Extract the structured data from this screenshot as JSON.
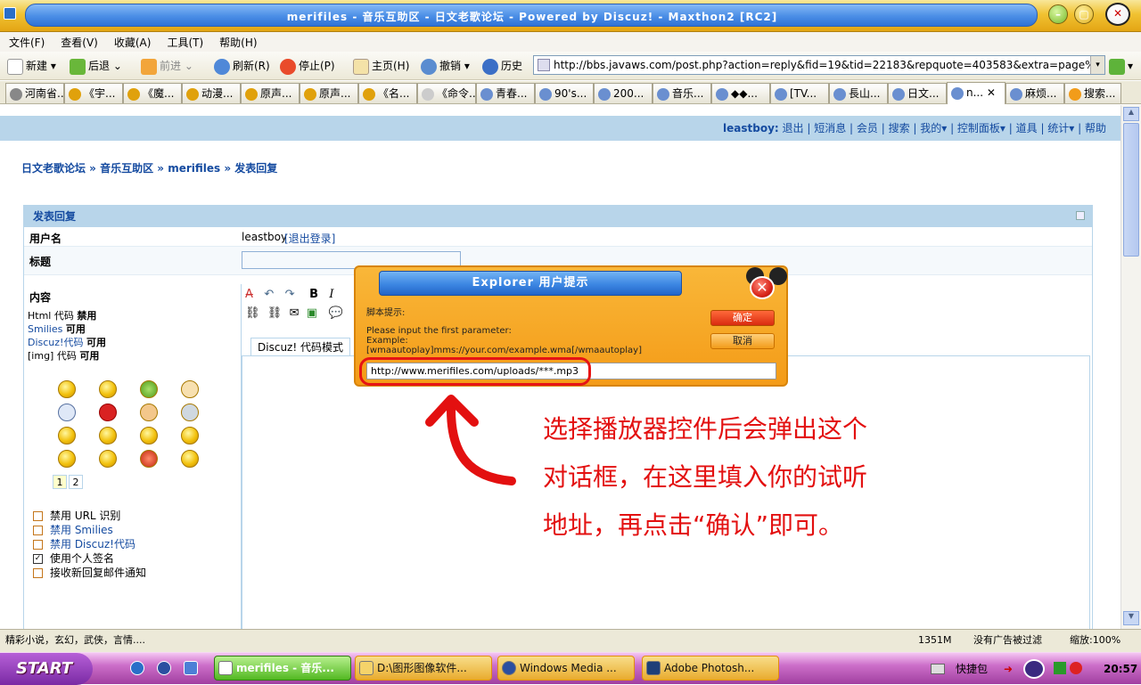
{
  "window": {
    "title": "merifiles - 音乐互助区 - 日文老歌论坛 - Powered by Discuz! - Maxthon2 [RC2]"
  },
  "menu": [
    "文件(F)",
    "查看(V)",
    "收藏(A)",
    "工具(T)",
    "帮助(H)"
  ],
  "toolbar": {
    "new": "新建",
    "back": "后退",
    "forward": "前进",
    "refresh": "刷新(R)",
    "stop": "停止(P)",
    "home": "主页(H)",
    "undo": "撤销",
    "history": "历史",
    "address": "http://bbs.javaws.com/post.php?action=reply&fid=19&tid=22183&repquote=403583&extra=page%3D1&"
  },
  "tabs": [
    "河南省...",
    "《宇...",
    "《魔...",
    "动漫...",
    "原声...",
    "原声...",
    "《名...",
    "《命令...",
    "青春...",
    "90's...",
    "200...",
    "音乐...",
    "◆◆...",
    "[TV...",
    "長山...",
    "日文...",
    "n...",
    "麻烦...",
    "搜索..."
  ],
  "userbar": {
    "user": "leastboy:",
    "links": "退出 | 短消息 | 会员 | 搜索 | 我的▾ | 控制面板▾ | 道具 | 统计▾ | 帮助"
  },
  "breadcrumb": "日文老歌论坛 » 音乐互助区 » merifiles » 发表回复",
  "form": {
    "header": "发表回复",
    "username_label": "用户名",
    "username_value": "leastboy",
    "logout_link": "[退出登录]",
    "subject_label": "标题",
    "content_label": "内容",
    "html_code": "Html 代码",
    "html_status": "禁用",
    "smilies": "Smilies",
    "smilies_status": "可用",
    "discuz_code": "Discuz!代码",
    "discuz_status": "可用",
    "img_code": "[img] 代码",
    "img_status": "可用",
    "pages": [
      "1",
      "2"
    ],
    "options": [
      "禁用 URL 识别",
      "禁用 Smilies",
      "禁用 Discuz!代码",
      "使用个人签名",
      "接收新回复邮件通知"
    ],
    "editor_tab": "Discuz! 代码模式"
  },
  "dialog": {
    "title": "Explorer 用户提示",
    "label": "脚本提示:",
    "line1": "Please input the first parameter:",
    "line2": "Example:",
    "line3": "[wmaautoplay]mms://your.com/example.wma[/wmaautoplay]",
    "ok": "确定",
    "cancel": "取消",
    "input": "http://www.merifiles.com/uploads/***.mp3"
  },
  "annotation": {
    "line1": "选择播放器控件后会弹出这个",
    "line2": "对话框，在这里填入你的试听",
    "line3": "地址，再点击“确认”即可。"
  },
  "status": {
    "left": "精彩小说，玄幻，武侠，言情....",
    "mem": "1351M",
    "adblock": "没有广告被过滤",
    "zoom": "缩放:100%"
  },
  "taskbar": {
    "start": "START",
    "buttons": [
      "merifiles - 音乐...",
      "D:\\图形图像软件...",
      "Windows Media ...",
      "Adobe Photosh..."
    ],
    "tray_label": "快捷包",
    "clock": "20:57"
  },
  "colors": {
    "link": "#154ba0",
    "header_bg": "#b8d5ea",
    "annotation": "#e31010"
  }
}
